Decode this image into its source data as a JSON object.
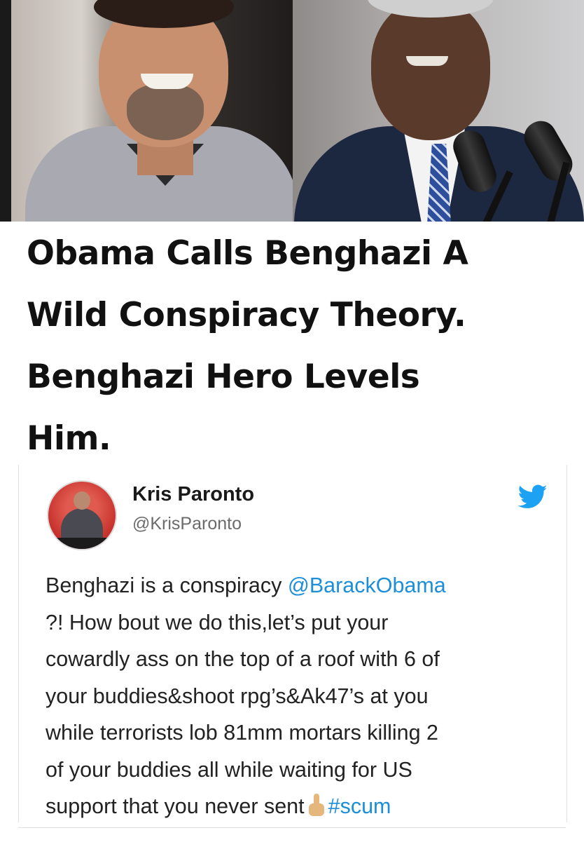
{
  "headline": {
    "lines": [
      "Obama Calls Benghazi A",
      "Wild Conspiracy Theory.",
      "Benghazi Hero Levels",
      "Him."
    ]
  },
  "tweet": {
    "author_name": "Kris Paronto",
    "author_handle": "@KrisParonto",
    "bird_icon": "twitter-bird-icon",
    "text": {
      "line1_pre": "Benghazi is a conspiracy ",
      "line1_mention": "@BarackObama",
      "line2": "?! How bout we do this,let’s put your",
      "line3": "cowardly ass on the top of a roof with 6 of",
      "line4": "your buddies&shoot rpg’s&Ak47’s at you",
      "line5": "while terrorists lob 81mm mortars killing 2",
      "line6": "of your buddies all while waiting for US",
      "line7_pre": "support that you never sent",
      "line7_emoji": "middle-finger-emoji",
      "line7_hashtag": "#scum"
    }
  },
  "colors": {
    "link_blue": "#1d8fd9",
    "headline_text": "#111111"
  }
}
